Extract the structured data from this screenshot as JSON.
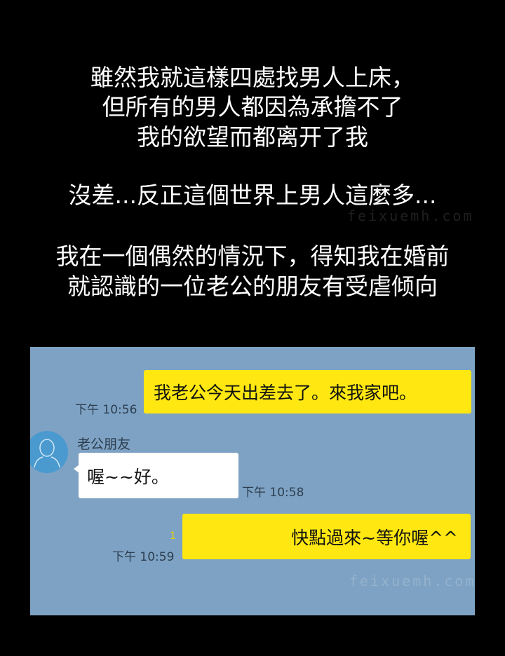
{
  "narration": {
    "lines": [
      "雖然我就這樣四處找男人上床，",
      "但所有的男人都因為承擔不了",
      "我的欲望而都离开了我",
      "沒差...反正這個世界上男人這麼多...",
      "我在一個偶然的情況下，得知我在婚前",
      "就認識的一位老公的朋友有受虐倾向"
    ]
  },
  "chat": {
    "messages": [
      {
        "sender": "me",
        "text": "我老公今天出差去了。來我家吧。",
        "time": "下午 10:56"
      },
      {
        "sender": "老公朋友",
        "text": "喔~~好。",
        "time": "下午 10:58"
      },
      {
        "sender": "me",
        "text": "快點過來~等你喔^^",
        "time": "下午 10:59",
        "unread": "1"
      }
    ],
    "colors": {
      "background": "#7ea2c3",
      "my_bubble": "#ffe812",
      "their_bubble": "#ffffff",
      "avatar": "#4a9ad0"
    }
  },
  "watermark": "feixuemh.com"
}
